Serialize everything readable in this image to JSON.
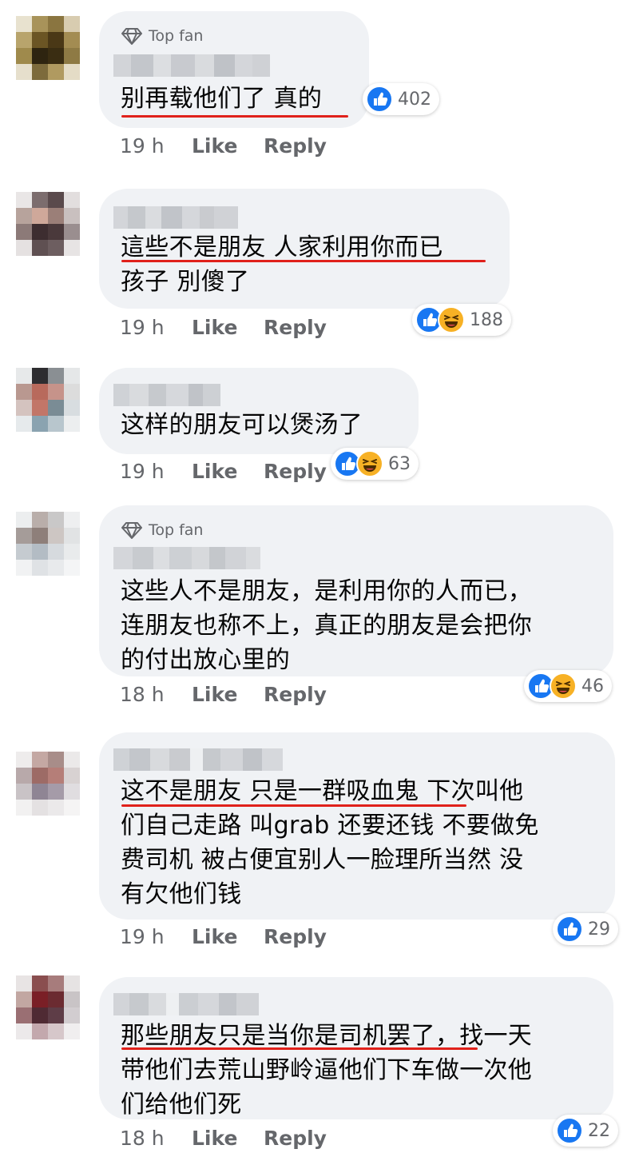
{
  "ui": {
    "top_fan_label": "Top fan",
    "like_label": "Like",
    "reply_label": "Reply"
  },
  "comments": [
    {
      "top_fan": true,
      "text": "别再载他们了 真的",
      "time": "19 h",
      "reactions": [
        "like"
      ],
      "count": "402"
    },
    {
      "top_fan": false,
      "text": "這些不是朋友 人家利用你而已\n孩子 別傻了",
      "time": "19 h",
      "reactions": [
        "like",
        "haha"
      ],
      "count": "188"
    },
    {
      "top_fan": false,
      "text": "这样的朋友可以煲汤了",
      "time": "19 h",
      "reactions": [
        "like",
        "haha"
      ],
      "count": "63"
    },
    {
      "top_fan": true,
      "text": "这些人不是朋友，是利用你的人而已，\n连朋友也称不上，真正的朋友是会把你\n的付出放心里的",
      "time": "18 h",
      "reactions": [
        "like",
        "haha"
      ],
      "count": "46"
    },
    {
      "top_fan": false,
      "text": "这不是朋友 只是一群吸血鬼 下次叫他\n们自己走路  叫grab 还要还钱 不要做免\n费司机 被占便宜别人一脸理所当然 没\n有欠他们钱",
      "time": "19 h",
      "reactions": [
        "like"
      ],
      "count": "29"
    },
    {
      "top_fan": false,
      "text": "那些朋友只是当你是司机罢了，找一天\n带他们去荒山野岭逼他们下车做一次他\n们给他们死",
      "time": "18 h",
      "reactions": [
        "like"
      ],
      "count": "22"
    }
  ],
  "colors": {
    "bubble": "#f0f2f5",
    "like_blue": "#1877f2",
    "haha_yellow": "#f7b125",
    "underline_red": "#e0211b",
    "meta_gray": "#65676b"
  },
  "icons": {
    "top_fan_badge": "diamond-icon",
    "like_reaction": "thumbs-up-icon",
    "haha_reaction": "laughing-face-icon"
  }
}
